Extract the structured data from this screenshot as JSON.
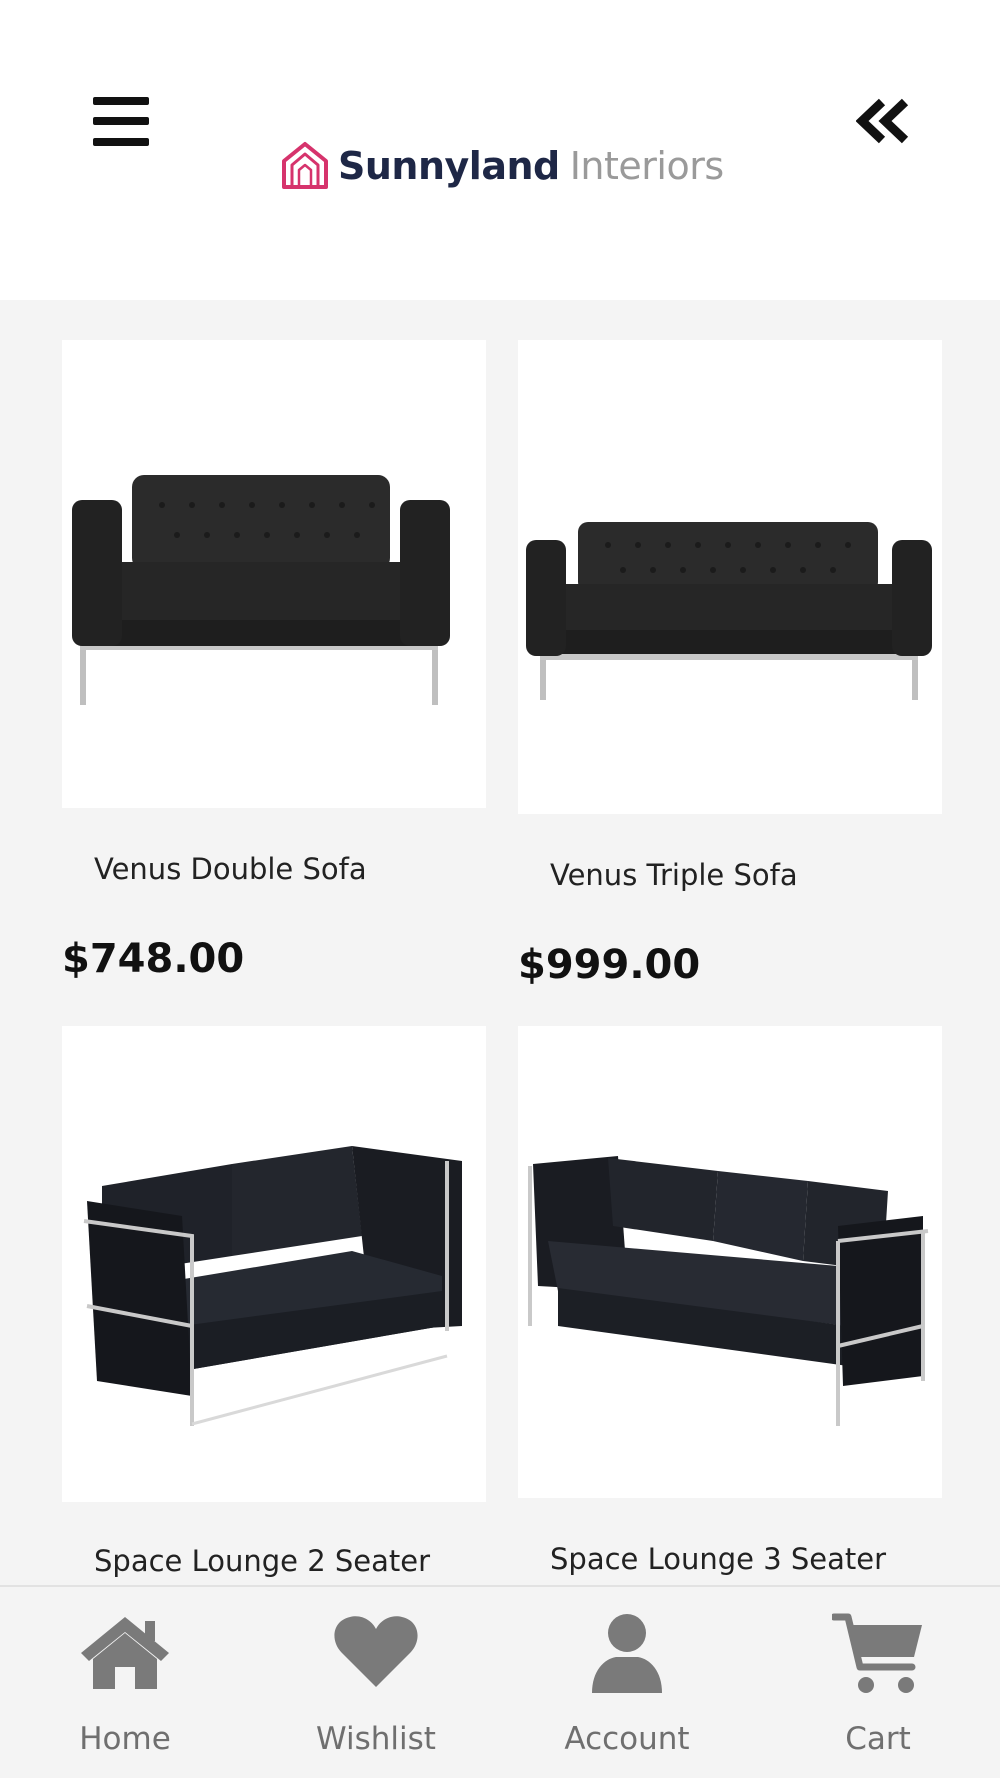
{
  "header": {
    "menu_icon": "hamburger-menu-icon",
    "back_icon": "double-chevron-left-icon",
    "logo": {
      "brand_strong": "Sunnyland",
      "brand_light": "Interiors",
      "accent_color": "#d6336c",
      "brand_color": "#1e2746",
      "light_color": "#9a9a9a"
    }
  },
  "products": [
    {
      "name": "Venus Double Sofa",
      "price": "$748.00",
      "image": "two-seat tufted black leather sofa"
    },
    {
      "name": "Venus Triple Sofa",
      "price": "$999.00",
      "image": "three-seat tufted black leather sofa"
    },
    {
      "name": "Space Lounge 2 Seater",
      "price": "",
      "image": "two-seat black cube lounge with chrome frame"
    },
    {
      "name": "Space Lounge 3 Seater",
      "price": "",
      "image": "three-seat black cube lounge with chrome frame"
    }
  ],
  "bottom_nav": [
    {
      "label": "Home",
      "icon": "home-icon"
    },
    {
      "label": "Wishlist",
      "icon": "heart-icon"
    },
    {
      "label": "Account",
      "icon": "user-icon"
    },
    {
      "label": "Cart",
      "icon": "cart-icon"
    }
  ],
  "colors": {
    "nav_icon": "#7a7a7a",
    "background": "#f4f4f4"
  }
}
